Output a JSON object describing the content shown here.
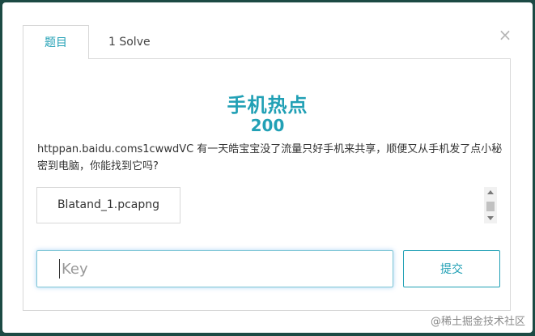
{
  "tabs": [
    {
      "label": "题目",
      "active": true
    },
    {
      "label": "1 Solve",
      "active": false
    }
  ],
  "close_symbol": "×",
  "challenge": {
    "title": "手机热点",
    "points": "200",
    "description": "httppan.baidu.coms1cwwdVC 有一天皓宝宝没了流量只好手机来共享，顺便又从手机发了点小秘密到电脑，你能找到它吗?"
  },
  "files": [
    {
      "name": "Blatand_1.pcapng"
    }
  ],
  "key_input": {
    "value": "",
    "placeholder": "Key"
  },
  "submit": {
    "label": "提交"
  },
  "watermark": "@稀土掘金技术社区",
  "colors": {
    "accent": "#21a0b5",
    "backdrop": "#1c4a44"
  },
  "icons": {
    "close": "close-icon"
  }
}
